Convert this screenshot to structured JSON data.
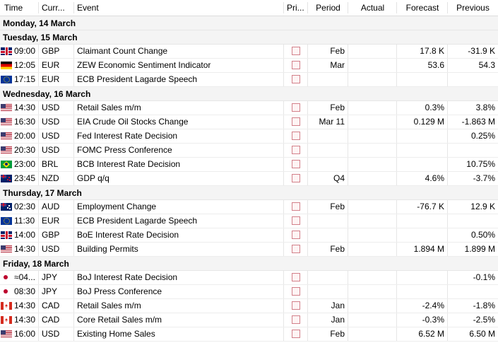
{
  "columns": {
    "time": "Time",
    "currency": "Curr...",
    "event": "Event",
    "priority": "Pri...",
    "period": "Period",
    "actual": "Actual",
    "forecast": "Forecast",
    "previous": "Previous"
  },
  "rows": [
    {
      "type": "group",
      "label": "Monday, 14 March"
    },
    {
      "type": "group",
      "label": "Tuesday, 15 March"
    },
    {
      "type": "event",
      "flag": "gb",
      "time": "09:00",
      "currency": "GBP",
      "event": "Claimant Count Change",
      "period": "Feb",
      "actual": "",
      "forecast": "17.8 K",
      "previous": "-31.9 K"
    },
    {
      "type": "event",
      "flag": "de",
      "time": "12:05",
      "currency": "EUR",
      "event": "ZEW Economic Sentiment Indicator",
      "period": "Mar",
      "actual": "",
      "forecast": "53.6",
      "previous": "54.3"
    },
    {
      "type": "event",
      "flag": "eu",
      "time": "17:15",
      "currency": "EUR",
      "event": "ECB President Lagarde Speech",
      "period": "",
      "actual": "",
      "forecast": "",
      "previous": ""
    },
    {
      "type": "group",
      "label": "Wednesday, 16 March"
    },
    {
      "type": "event",
      "flag": "us",
      "time": "14:30",
      "currency": "USD",
      "event": "Retail Sales m/m",
      "period": "Feb",
      "actual": "",
      "forecast": "0.3%",
      "previous": "3.8%"
    },
    {
      "type": "event",
      "flag": "us",
      "time": "16:30",
      "currency": "USD",
      "event": "EIA Crude Oil Stocks Change",
      "period": "Mar 11",
      "actual": "",
      "forecast": "0.129 M",
      "previous": "-1.863 M"
    },
    {
      "type": "event",
      "flag": "us",
      "time": "20:00",
      "currency": "USD",
      "event": "Fed Interest Rate Decision",
      "period": "",
      "actual": "",
      "forecast": "",
      "previous": "0.25%"
    },
    {
      "type": "event",
      "flag": "us",
      "time": "20:30",
      "currency": "USD",
      "event": "FOMC Press Conference",
      "period": "",
      "actual": "",
      "forecast": "",
      "previous": ""
    },
    {
      "type": "event",
      "flag": "br",
      "time": "23:00",
      "currency": "BRL",
      "event": "BCB Interest Rate Decision",
      "period": "",
      "actual": "",
      "forecast": "",
      "previous": "10.75%"
    },
    {
      "type": "event",
      "flag": "nz",
      "time": "23:45",
      "currency": "NZD",
      "event": "GDP q/q",
      "period": "Q4",
      "actual": "",
      "forecast": "4.6%",
      "previous": "-3.7%"
    },
    {
      "type": "group",
      "label": "Thursday, 17 March"
    },
    {
      "type": "event",
      "flag": "au",
      "time": "02:30",
      "currency": "AUD",
      "event": "Employment Change",
      "period": "Feb",
      "actual": "",
      "forecast": "-76.7 K",
      "previous": "12.9 K"
    },
    {
      "type": "event",
      "flag": "eu",
      "time": "11:30",
      "currency": "EUR",
      "event": "ECB President Lagarde Speech",
      "period": "",
      "actual": "",
      "forecast": "",
      "previous": ""
    },
    {
      "type": "event",
      "flag": "gb",
      "time": "14:00",
      "currency": "GBP",
      "event": "BoE Interest Rate Decision",
      "period": "",
      "actual": "",
      "forecast": "",
      "previous": "0.50%"
    },
    {
      "type": "event",
      "flag": "us",
      "time": "14:30",
      "currency": "USD",
      "event": "Building Permits",
      "period": "Feb",
      "actual": "",
      "forecast": "1.894 M",
      "previous": "1.899 M"
    },
    {
      "type": "group",
      "label": "Friday, 18 March"
    },
    {
      "type": "event",
      "flag": "jp",
      "time": "≈04...",
      "currency": "JPY",
      "event": "BoJ Interest Rate Decision",
      "period": "",
      "actual": "",
      "forecast": "",
      "previous": "-0.1%"
    },
    {
      "type": "event",
      "flag": "jp",
      "time": "08:30",
      "currency": "JPY",
      "event": "BoJ Press Conference",
      "period": "",
      "actual": "",
      "forecast": "",
      "previous": ""
    },
    {
      "type": "event",
      "flag": "ca",
      "time": "14:30",
      "currency": "CAD",
      "event": "Retail Sales m/m",
      "period": "Jan",
      "actual": "",
      "forecast": "-2.4%",
      "previous": "-1.8%"
    },
    {
      "type": "event",
      "flag": "ca",
      "time": "14:30",
      "currency": "CAD",
      "event": "Core Retail Sales m/m",
      "period": "Jan",
      "actual": "",
      "forecast": "-0.3%",
      "previous": "-2.5%"
    },
    {
      "type": "event",
      "flag": "us",
      "time": "16:00",
      "currency": "USD",
      "event": "Existing Home Sales",
      "period": "Feb",
      "actual": "",
      "forecast": "6.52 M",
      "previous": "6.50 M"
    }
  ]
}
